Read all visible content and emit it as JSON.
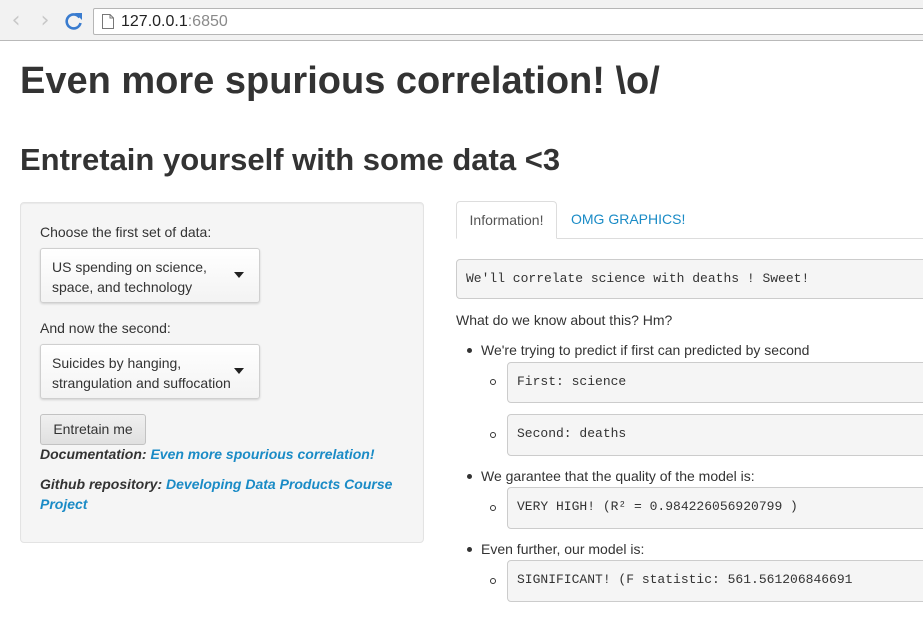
{
  "browser": {
    "url_host": "127.0.0.1",
    "url_port": ":6850"
  },
  "page": {
    "title": "Even more spurious correlation! \\o/",
    "subtitle": "Entretain yourself with some data <3"
  },
  "sidebar": {
    "first_label": "Choose the first set of data:",
    "first_select_line1": "US spending on science,",
    "first_select_line2": "space, and technology",
    "second_label": "And now the second:",
    "second_select_line1": "Suicides by hanging,",
    "second_select_line2": "strangulation and suffocation",
    "button_label": "Entretain me",
    "doc_label": "Documentation:",
    "doc_link": "Even more spourious correlation!",
    "github_label": "Github repository:",
    "github_link_line1": "Developing Data Products Course",
    "github_link_line2": "Project"
  },
  "tabs": [
    {
      "label": "Information!",
      "active": true
    },
    {
      "label": "OMG GRAPHICS!",
      "active": false
    }
  ],
  "main": {
    "intro_code": "We'll correlate science with deaths ! Sweet!",
    "question": "What do we know about this? Hm?",
    "bullet1": "We're trying to predict if first can predicted by second",
    "first_code": "First: science",
    "second_code": "Second: deaths",
    "bullet2": "We garantee that the quality of the model is:",
    "quality_code": "VERY HIGH! (R² = 0.984226056920799 )",
    "bullet3": "Even further, our model is:",
    "significance_code": "SIGNIFICANT! (F statistic: 561.561206846691"
  },
  "icons": {
    "back": "back-arrow-icon",
    "forward": "forward-arrow-icon",
    "reload": "reload-icon",
    "page": "page-icon",
    "dropdown": "caret-down-icon"
  },
  "colors": {
    "link": "#1a8bc6",
    "reload": "#3a7ccf"
  }
}
